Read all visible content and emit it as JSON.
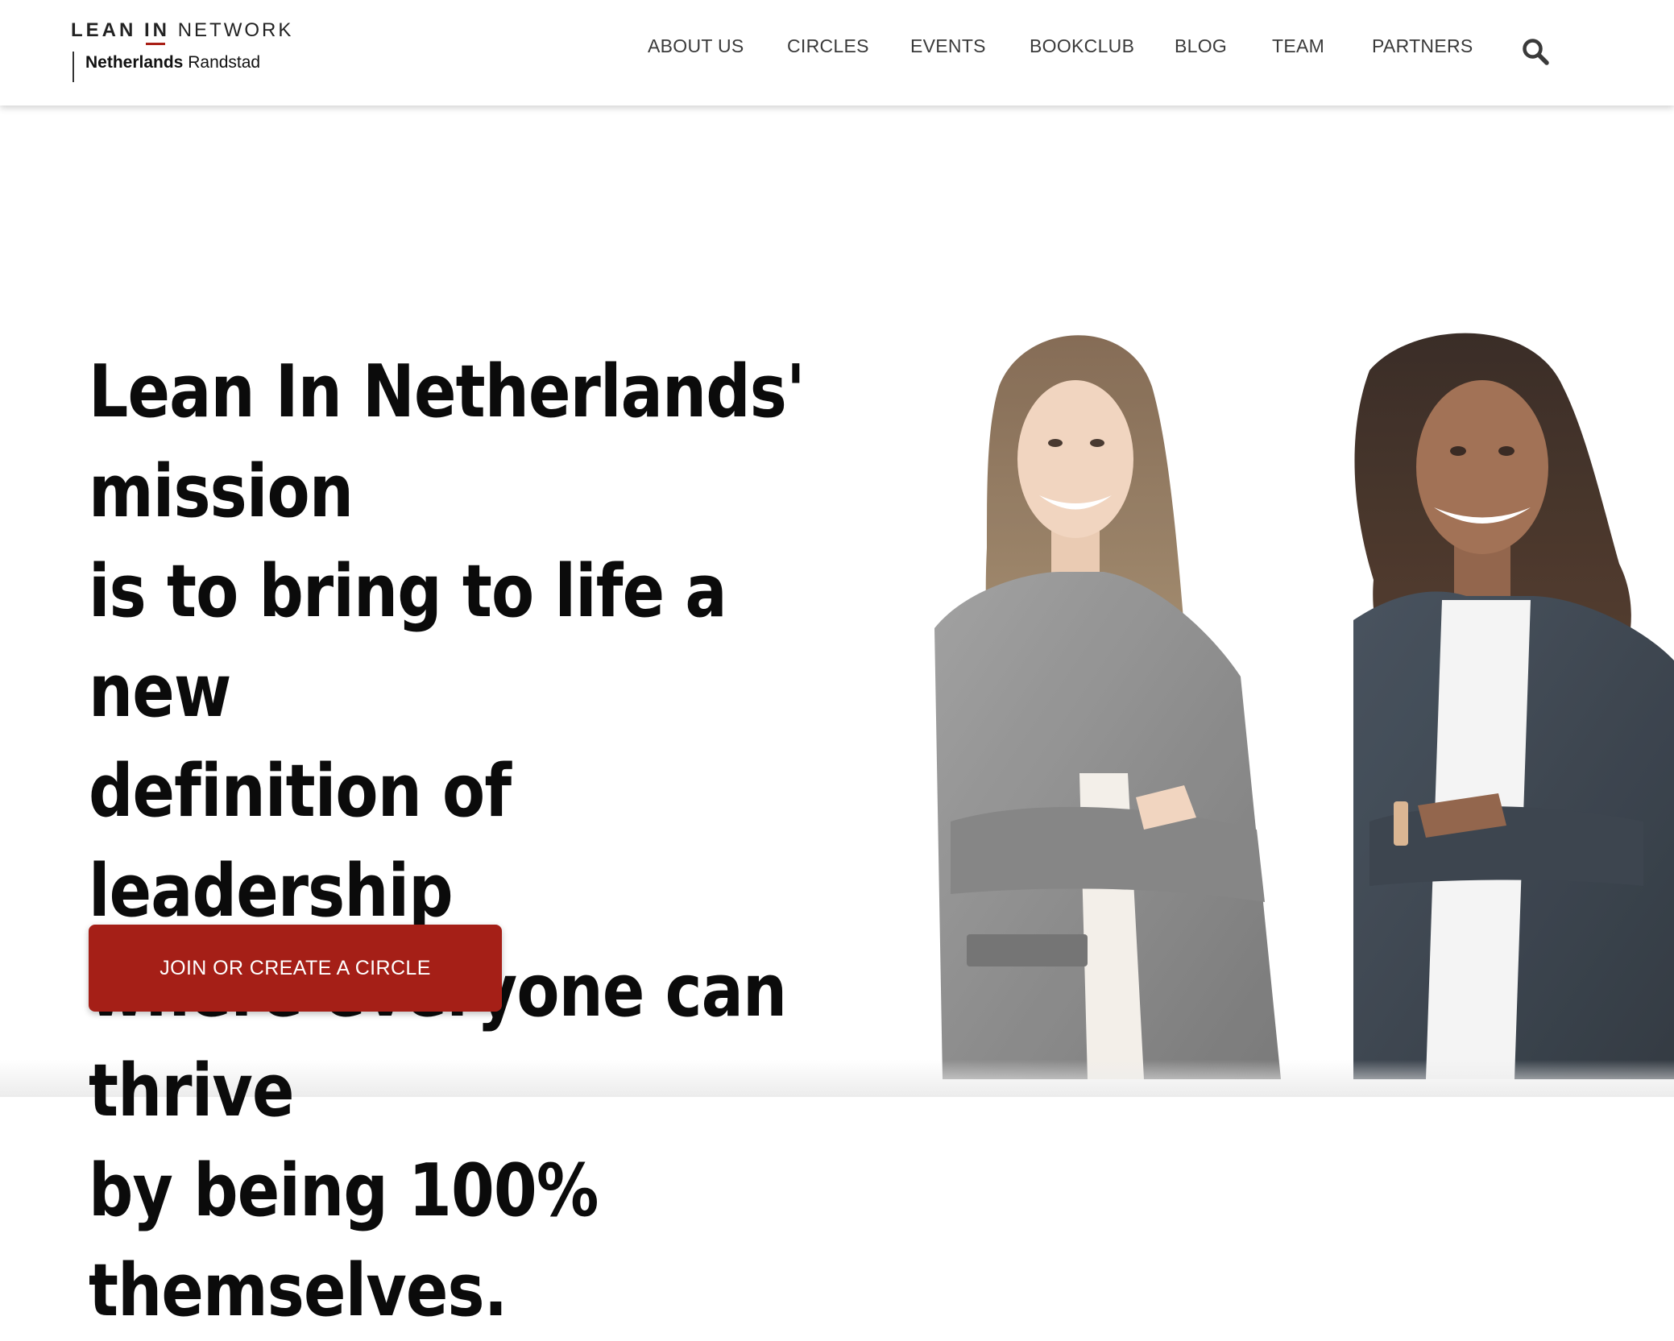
{
  "logo": {
    "line1_lean": "LEAN",
    "line1_in": "IN",
    "line1_network": "NETWORK",
    "line2_bold": "Netherlands",
    "line2_regular": "Randstad"
  },
  "nav": {
    "items": [
      {
        "label": "ABOUT US"
      },
      {
        "label": "CIRCLES"
      },
      {
        "label": "EVENTS"
      },
      {
        "label": "BOOKCLUB"
      },
      {
        "label": "BLOG"
      },
      {
        "label": "TEAM"
      },
      {
        "label": "PARTNERS"
      }
    ],
    "search_icon": "search-icon"
  },
  "hero": {
    "title_lines": [
      "Lean In Netherlands' mission",
      "is to bring to life a new",
      "definition of leadership",
      "where everyone can thrive",
      "by being 100% themselves."
    ],
    "cta_label": "JOIN OR CREATE A CIRCLE",
    "image": "two-smiling-women-in-blazers-photo"
  },
  "colors": {
    "accent": "#a51f17",
    "nav_text": "#3a3a3a",
    "title_text": "#0b0b0b",
    "background": "#ffffff"
  }
}
